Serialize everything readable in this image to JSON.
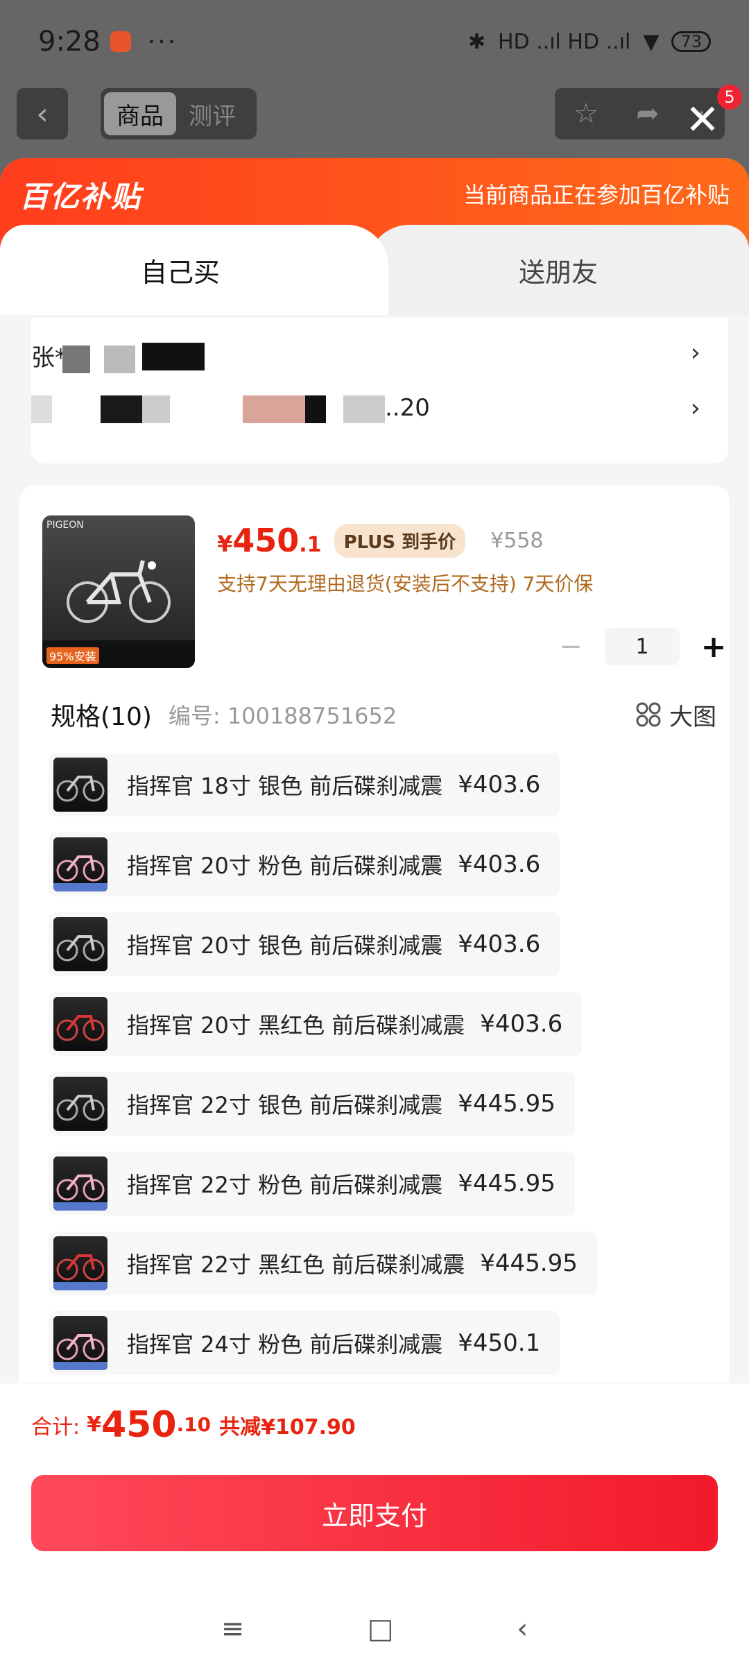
{
  "status_bar": {
    "time": "9:28",
    "more": "···",
    "signal": "HD ..ıl HD ..ıl",
    "battery": "73"
  },
  "top_nav": {
    "tabs": [
      "商品",
      "测评"
    ],
    "active_tab": "商品",
    "badge_count": "5"
  },
  "promo": {
    "logo": "百亿补贴",
    "text": "当前商品正在参加百亿补贴"
  },
  "buy_tabs": {
    "self": "自己买",
    "gift": "送朋友"
  },
  "address": {
    "line1": "张*",
    "line2": "..20"
  },
  "product": {
    "brand": "PIGEON",
    "badge": "95%安装",
    "price_symbol": "¥",
    "price_main": "450",
    "price_decimal": ".1",
    "plus_tag": "PLUS 到手价",
    "original_price": "¥558",
    "service": "支持7天无理由退货(安装后不支持)  7天价保",
    "quantity": "1"
  },
  "spec": {
    "title": "规格(10)",
    "code": "编号: 100188751652",
    "big_view": "大图",
    "items": [
      {
        "label": "指挥官 18寸 银色 前后碟刹减震",
        "price": "¥403.6",
        "tone": "silver"
      },
      {
        "label": "指挥官 20寸 粉色 前后碟刹减震",
        "price": "¥403.6",
        "tone": "pink"
      },
      {
        "label": "指挥官 20寸 银色 前后碟刹减震",
        "price": "¥403.6",
        "tone": "silver"
      },
      {
        "label": "指挥官 20寸 黑红色 前后碟刹减震",
        "price": "¥403.6",
        "tone": "red"
      },
      {
        "label": "指挥官 22寸 银色 前后碟刹减震",
        "price": "¥445.95",
        "tone": "silver"
      },
      {
        "label": "指挥官 22寸 粉色 前后碟刹减震",
        "price": "¥445.95",
        "tone": "pink"
      },
      {
        "label": "指挥官 22寸 黑红色 前后碟刹减震",
        "price": "¥445.95",
        "tone": "red"
      },
      {
        "label": "指挥官 24寸 粉色 前后碟刹减震",
        "price": "¥450.1",
        "tone": "pink"
      }
    ]
  },
  "total": {
    "label": "合计:",
    "symbol": "¥",
    "main": "450",
    "decimal": ".10",
    "discount": "共减¥107.90"
  },
  "pay_button": "立即支付",
  "nav_bar": {
    "menu": "≡",
    "home": "□",
    "back": "‹"
  },
  "colors": {
    "accent": "#e8230f",
    "promo": "#ff4a1c",
    "pay": "#f21a2b"
  }
}
